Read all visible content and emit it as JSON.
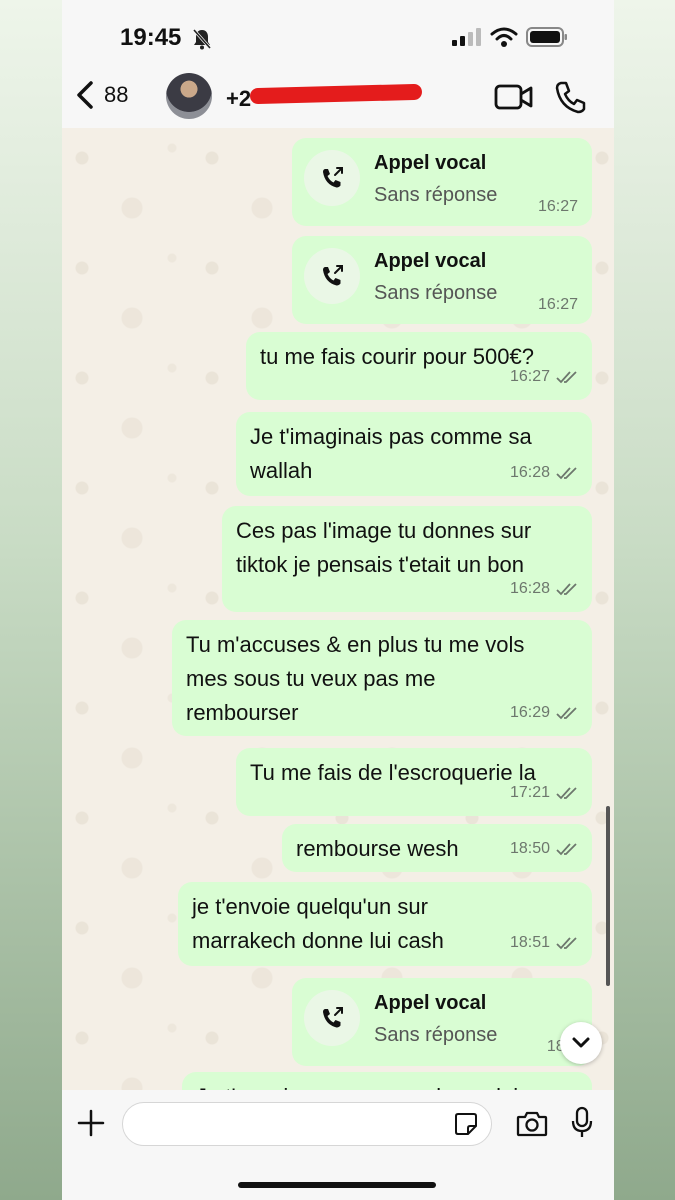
{
  "status_bar": {
    "time": "19:45"
  },
  "header": {
    "back_count": "88",
    "contact_name": "+2"
  },
  "messages": [
    {
      "kind": "call",
      "title": "Appel vocal",
      "subtitle": "Sans réponse",
      "time": "16:27"
    },
    {
      "kind": "call",
      "title": "Appel vocal",
      "subtitle": "Sans réponse",
      "time": "16:27"
    },
    {
      "kind": "text",
      "text": "tu me fais courir pour 500€?",
      "time": "16:27"
    },
    {
      "kind": "text",
      "text": "Je t'imaginais pas comme sa\nwallah",
      "time": "16:28"
    },
    {
      "kind": "text",
      "text": "Ces pas l'image tu donnes sur\ntiktok je pensais t'etait un bon",
      "time": "16:28"
    },
    {
      "kind": "text",
      "text": "Tu m'accuses & en plus tu me vols\nmes sous tu veux pas me\nrembourser",
      "time": "16:29"
    },
    {
      "kind": "text",
      "text": "Tu me fais de l'escroquerie la",
      "time": "17:21"
    },
    {
      "kind": "text",
      "text": "rembourse wesh",
      "time": "18:50"
    },
    {
      "kind": "text",
      "text": "je t'envoie quelqu'un sur\nmarrakech donne lui cash",
      "time": "18:51"
    },
    {
      "kind": "call",
      "title": "Appel vocal",
      "subtitle": "Sans réponse",
      "time": "18:5"
    },
    {
      "kind": "text",
      "text": "Je t'envoie son numero donne lui",
      "time": ""
    }
  ],
  "composer": {
    "placeholder": ""
  },
  "icons": [
    "bell-slash-icon",
    "signal-icon",
    "wifi-icon",
    "battery-icon",
    "chevron-left-icon",
    "video-icon",
    "phone-icon",
    "outgoing-call-icon",
    "double-check-icon",
    "chevron-down-icon",
    "plus-icon",
    "sticker-icon",
    "camera-icon",
    "mic-icon"
  ],
  "colors": {
    "bubble": "#d9fdd3",
    "chat_bg": "#f4efe6",
    "bar_bg": "#f7f7f7",
    "redaction": "#e41c1c"
  }
}
